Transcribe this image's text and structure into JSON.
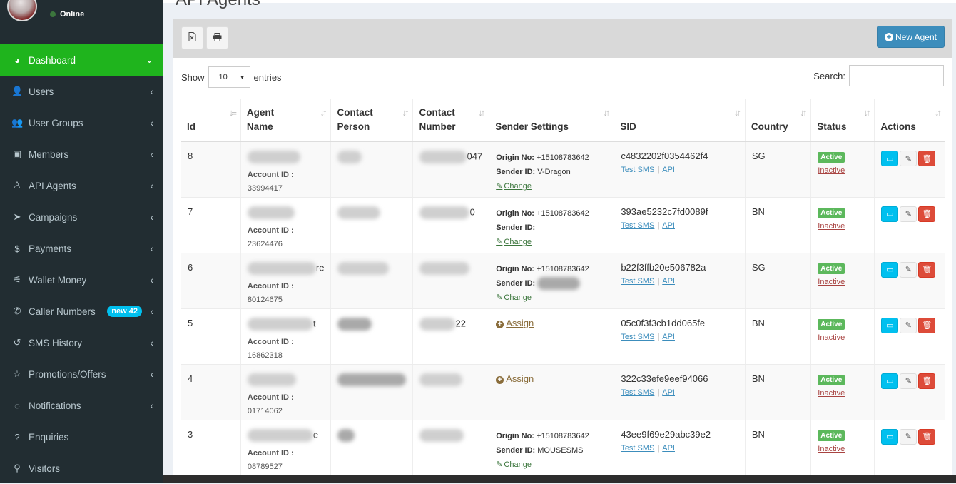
{
  "sidebar": {
    "status": "Online",
    "items": [
      {
        "label": "Dashboard",
        "icon": "dashboard-icon",
        "glyph": "◕",
        "chev": "⌄"
      },
      {
        "label": "Users",
        "icon": "user-icon",
        "glyph": "👤",
        "chev": "‹"
      },
      {
        "label": "User Groups",
        "icon": "users-icon",
        "glyph": "👥",
        "chev": "‹"
      },
      {
        "label": "Members",
        "icon": "briefcase-icon",
        "glyph": "▣",
        "chev": "‹"
      },
      {
        "label": "API Agents",
        "icon": "person-icon",
        "glyph": "♙",
        "chev": "‹"
      },
      {
        "label": "Campaigns",
        "icon": "paper-plane-icon",
        "glyph": "➤",
        "chev": "‹"
      },
      {
        "label": "Payments",
        "icon": "dollar-icon",
        "glyph": "$",
        "chev": "‹"
      },
      {
        "label": "Wallet Money",
        "icon": "wallet-icon",
        "glyph": "⚟",
        "chev": "‹"
      },
      {
        "label": "Caller Numbers",
        "icon": "phone-icon",
        "glyph": "✆",
        "chev": "‹",
        "badge": "new 42"
      },
      {
        "label": "SMS History",
        "icon": "history-icon",
        "glyph": "↺",
        "chev": "‹"
      },
      {
        "label": "Promotions/Offers",
        "icon": "star-icon",
        "glyph": "☆",
        "chev": "‹"
      },
      {
        "label": "Notifications",
        "icon": "comment-icon",
        "glyph": "◌",
        "chev": "‹"
      },
      {
        "label": "Enquiries",
        "icon": "question-icon",
        "glyph": "?",
        "chev": ""
      },
      {
        "label": "Visitors",
        "icon": "map-marker-icon",
        "glyph": "⚲",
        "chev": ""
      }
    ]
  },
  "page": {
    "title": "API Agents"
  },
  "toolbar": {
    "excel_icon": "excel-icon",
    "print_icon": "print-icon",
    "new_agent_label": "New Agent"
  },
  "table_controls": {
    "show_label": "Show",
    "length_value": "10",
    "entries_label": "entries",
    "search_label": "Search:",
    "search_placeholder": ""
  },
  "columns": [
    {
      "line1": "",
      "line2": "Id"
    },
    {
      "line1": "Agent",
      "line2": "Name"
    },
    {
      "line1": "Contact",
      "line2": "Person"
    },
    {
      "line1": "Contact",
      "line2": "Number"
    },
    {
      "line1": "",
      "line2": "Sender Settings"
    },
    {
      "line1": "",
      "line2": "SID"
    },
    {
      "line1": "",
      "line2": "Country"
    },
    {
      "line1": "",
      "line2": "Status"
    },
    {
      "line1": "",
      "line2": "Actions"
    }
  ],
  "labels": {
    "account_id": "Account ID :",
    "origin_no": "Origin No:",
    "sender_id": "Sender ID:",
    "change": "Change",
    "assign": "Assign",
    "test_sms": "Test SMS",
    "api": "API",
    "separator": "|",
    "active": "Active",
    "inactive": "Inactive"
  },
  "rows": [
    {
      "id": "8",
      "name_tail": "",
      "number_tail": "047",
      "account_id": "33994417",
      "settings": "configured",
      "origin_no": "+15108783642",
      "sender_id": "V-Dragon",
      "sid": "c4832202f0354462f4",
      "country": "SG"
    },
    {
      "id": "7",
      "name_tail": "",
      "number_tail": "0",
      "account_id": "23624476",
      "settings": "configured",
      "origin_no": "+15108783642",
      "sender_id": "",
      "sid": "393ae5232c7fd0089f",
      "country": "BN"
    },
    {
      "id": "6",
      "name_tail": "re",
      "number_tail": "",
      "account_id": "80124675",
      "settings": "configured",
      "origin_no": "+15108783642",
      "sender_id": "",
      "sid": "b22f3ffb20e506782a",
      "country": "SG"
    },
    {
      "id": "5",
      "name_tail": "t",
      "number_tail": "22",
      "account_id": "16862318",
      "settings": "assign",
      "origin_no": "",
      "sender_id": "",
      "sid": "05c0f3f3cb1dd065fe",
      "country": "BN"
    },
    {
      "id": "4",
      "name_tail": "",
      "number_tail": "",
      "account_id": "01714062",
      "settings": "assign",
      "origin_no": "",
      "sender_id": "",
      "sid": "322c33efe9eef94066",
      "country": "BN"
    },
    {
      "id": "3",
      "name_tail": "e",
      "number_tail": "",
      "account_id": "08789527",
      "settings": "configured",
      "origin_no": "+15108783642",
      "sender_id": "MOUSESMS",
      "sid": "43ee9f69e29abc39e2",
      "country": "BN"
    }
  ]
}
